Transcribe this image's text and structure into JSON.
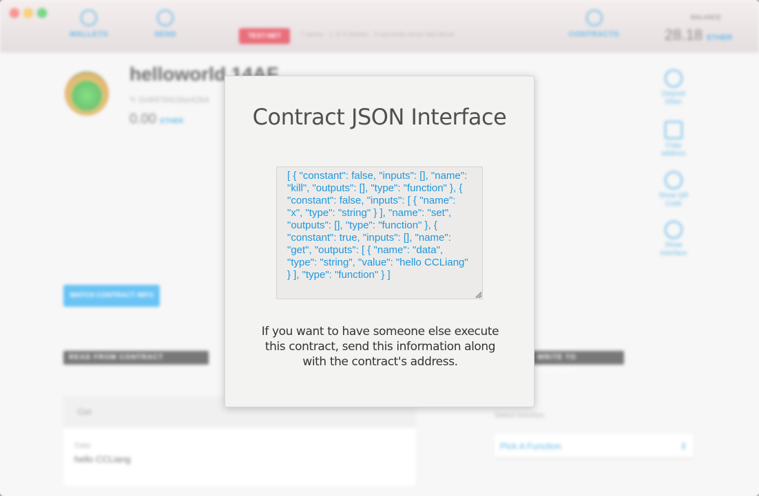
{
  "window": {
    "traffic_lights": [
      "close",
      "minimize",
      "maximize"
    ]
  },
  "header": {
    "nav": [
      {
        "label": "WALLETS",
        "icon": "wallet-icon"
      },
      {
        "label": "SEND",
        "icon": "send-icon"
      },
      {
        "label": "CONTRACTS",
        "icon": "contracts-icon"
      }
    ],
    "network_badge": "TEST-NET",
    "peer_info": "7 peers · 1 of 5 blocks · 0 seconds since last block",
    "balance_label": "BALANCE",
    "balance_value": "28.18",
    "balance_unit": "ETHER"
  },
  "contract": {
    "name": "helloworld 14AF",
    "address": "0x4f4784c5be42b4",
    "balance_value": "0.00",
    "balance_unit": "ETHER",
    "watch_button": "WATCH CONTRACT INFO"
  },
  "side_actions": [
    {
      "label": "Deposit Ether",
      "icon": "deposit-icon"
    },
    {
      "label": "Copy address",
      "icon": "copy-icon"
    },
    {
      "label": "Show QR Code",
      "icon": "qr-icon"
    },
    {
      "label": "Show Interface",
      "icon": "interface-icon"
    }
  ],
  "sections": {
    "read_title": "READ FROM CONTRACT",
    "write_title": "WRITE TO CONTRACT",
    "read_function": "Get",
    "data_label": "Data",
    "data_value": "hello CCLiang",
    "select_label": "Select function",
    "select_value": "Pick A Function",
    "select_arrow": "⇕"
  },
  "modal": {
    "title": "Contract JSON Interface",
    "json_text": "[ { \"constant\": false, \"inputs\": [], \"name\": \"kill\", \"outputs\": [], \"type\": \"function\" }, { \"constant\": false, \"inputs\": [ { \"name\": \"x\", \"type\": \"string\" } ], \"name\": \"set\", \"outputs\": [], \"type\": \"function\" }, { \"constant\": true, \"inputs\": [], \"name\": \"get\", \"outputs\": [ { \"name\": \"data\", \"type\": \"string\", \"value\": \"hello CCLiang\" } ], \"type\": \"function\" } ]",
    "description": "If you want to have someone else execute this contract, send this information along with the contract's address."
  }
}
